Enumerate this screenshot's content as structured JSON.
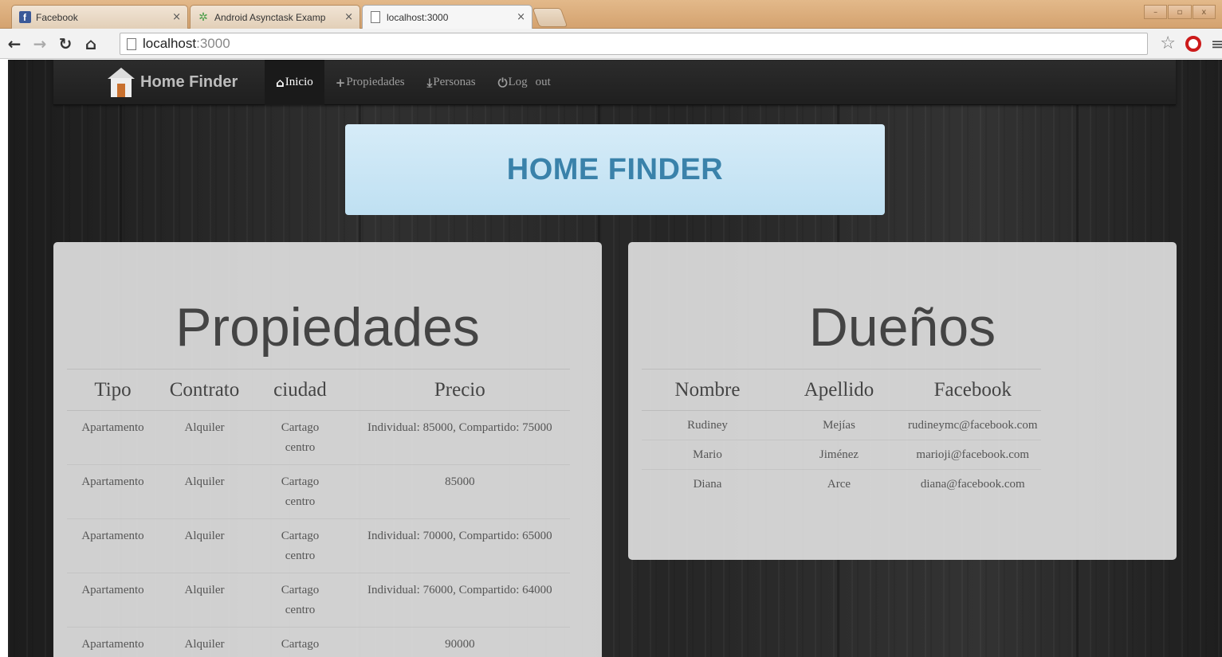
{
  "browser": {
    "tabs": [
      {
        "title": "Facebook",
        "close": "×"
      },
      {
        "title": "Android Asynctask Examp",
        "close": "×"
      },
      {
        "title": "localhost:3000",
        "close": "×"
      }
    ],
    "window_controls": [
      "–",
      "▫",
      "x"
    ],
    "url_host": "localhost",
    "url_port": ":3000"
  },
  "navbar": {
    "brand": "Home Finder",
    "links": [
      {
        "icon": "home-icon",
        "label": "Inicio"
      },
      {
        "icon": "plus-icon",
        "label": "Propiedades"
      },
      {
        "icon": "download-icon",
        "label": "Personas"
      },
      {
        "icon": "power-icon",
        "label": "Log",
        "label2": "out"
      }
    ]
  },
  "hero": {
    "title": "HOME FINDER"
  },
  "propiedades": {
    "title": "Propiedades",
    "headers": [
      "Tipo",
      "Contrato",
      "ciudad",
      "Precio"
    ],
    "rows": [
      [
        "Apartamento",
        "Alquiler",
        "Cartago centro",
        "Individual: 85000, Compartido: 75000"
      ],
      [
        "Apartamento",
        "Alquiler",
        "Cartago centro",
        "85000"
      ],
      [
        "Apartamento",
        "Alquiler",
        "Cartago centro",
        "Individual: 70000, Compartido: 65000"
      ],
      [
        "Apartamento",
        "Alquiler",
        "Cartago centro",
        "Individual: 76000, Compartido: 64000"
      ],
      [
        "Apartamento",
        "Alquiler",
        "Cartago centro",
        "90000"
      ]
    ]
  },
  "duenos": {
    "title": "Dueños",
    "headers": [
      "Nombre",
      "Apellido",
      "Facebook"
    ],
    "rows": [
      [
        "Rudiney",
        "Mejías",
        "rudineymc@facebook.com"
      ],
      [
        "Mario",
        "Jiménez",
        "marioji@facebook.com"
      ],
      [
        "Diana",
        "Arce",
        "diana@facebook.com"
      ]
    ]
  },
  "colors": {
    "hero_text": "#3a82aa",
    "hero_bg": "#cbe6f5",
    "navbar_bg": "#222222",
    "panel_bg": "#dedede"
  }
}
